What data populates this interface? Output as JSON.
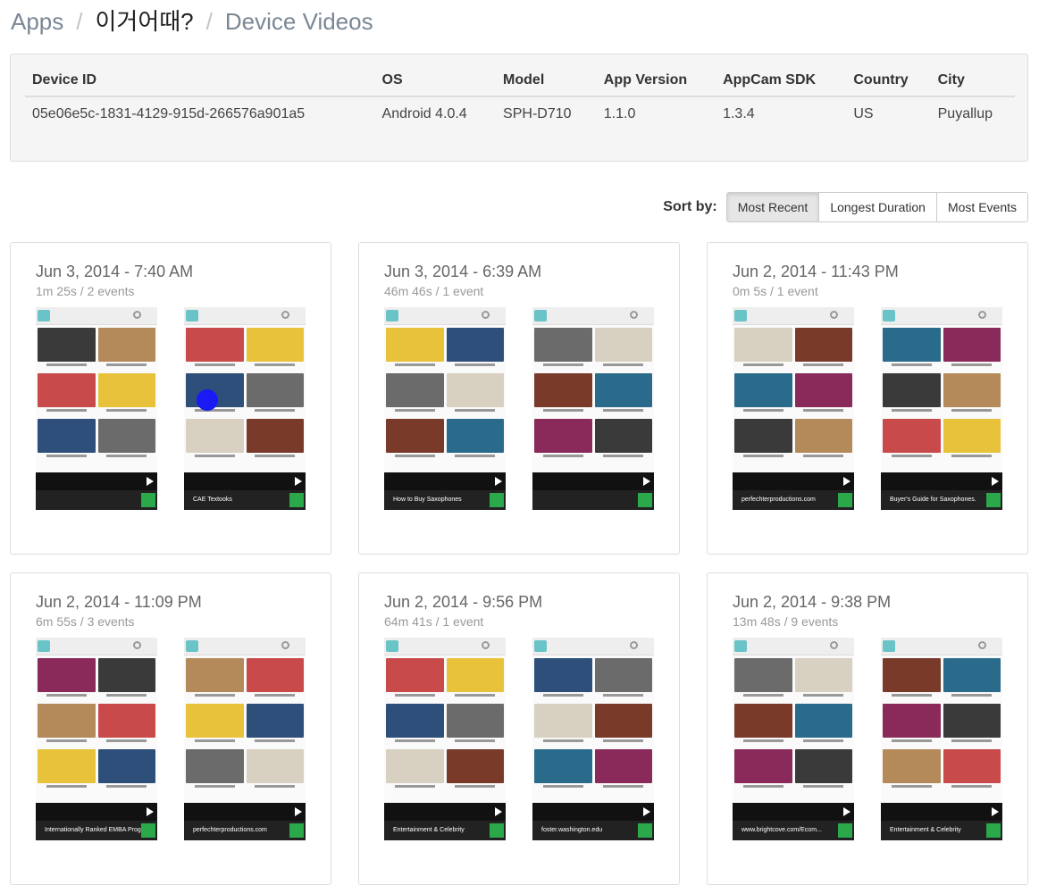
{
  "breadcrumb": {
    "apps": "Apps",
    "app_name": "이거어때?",
    "current": "Device Videos"
  },
  "device": {
    "headers": [
      "Device ID",
      "OS",
      "Model",
      "App Version",
      "AppCam SDK",
      "Country",
      "City"
    ],
    "row": [
      "05e06e5c-1831-4129-915d-266576a901a5",
      "Android 4.0.4",
      "SPH-D710",
      "1.1.0",
      "1.3.4",
      "US",
      "Puyallup"
    ]
  },
  "sort": {
    "label": "Sort by:",
    "options": [
      "Most Recent",
      "Longest Duration",
      "Most Events"
    ],
    "selected": "Most Recent"
  },
  "sessions": [
    {
      "datetime": "Jun 3, 2014 - 7:40 AM",
      "summary": "1m 25s / 2 events",
      "ads": [
        "",
        "CAE Textooks"
      ]
    },
    {
      "datetime": "Jun 3, 2014 - 6:39 AM",
      "summary": "46m 46s / 1 event",
      "ads": [
        "How to Buy Saxophones",
        ""
      ]
    },
    {
      "datetime": "Jun 2, 2014 - 11:43 PM",
      "summary": "0m 5s / 1 event",
      "ads": [
        "perfechterproductions.com",
        "Buyer's Guide for Saxophones."
      ]
    },
    {
      "datetime": "Jun 2, 2014 - 11:09 PM",
      "summary": "6m 55s / 3 events",
      "ads": [
        "Internationally Ranked EMBA Program",
        "perfechterproductions.com"
      ]
    },
    {
      "datetime": "Jun 2, 2014 - 9:56 PM",
      "summary": "64m 41s / 1 event",
      "ads": [
        "Entertainment & Celebrity",
        "foster.washington.edu"
      ]
    },
    {
      "datetime": "Jun 2, 2014 - 9:38 PM",
      "summary": "13m 48s / 9 events",
      "ads": [
        "www.brightcove.com/Ecom...",
        "Entertainment & Celebrity"
      ]
    }
  ]
}
